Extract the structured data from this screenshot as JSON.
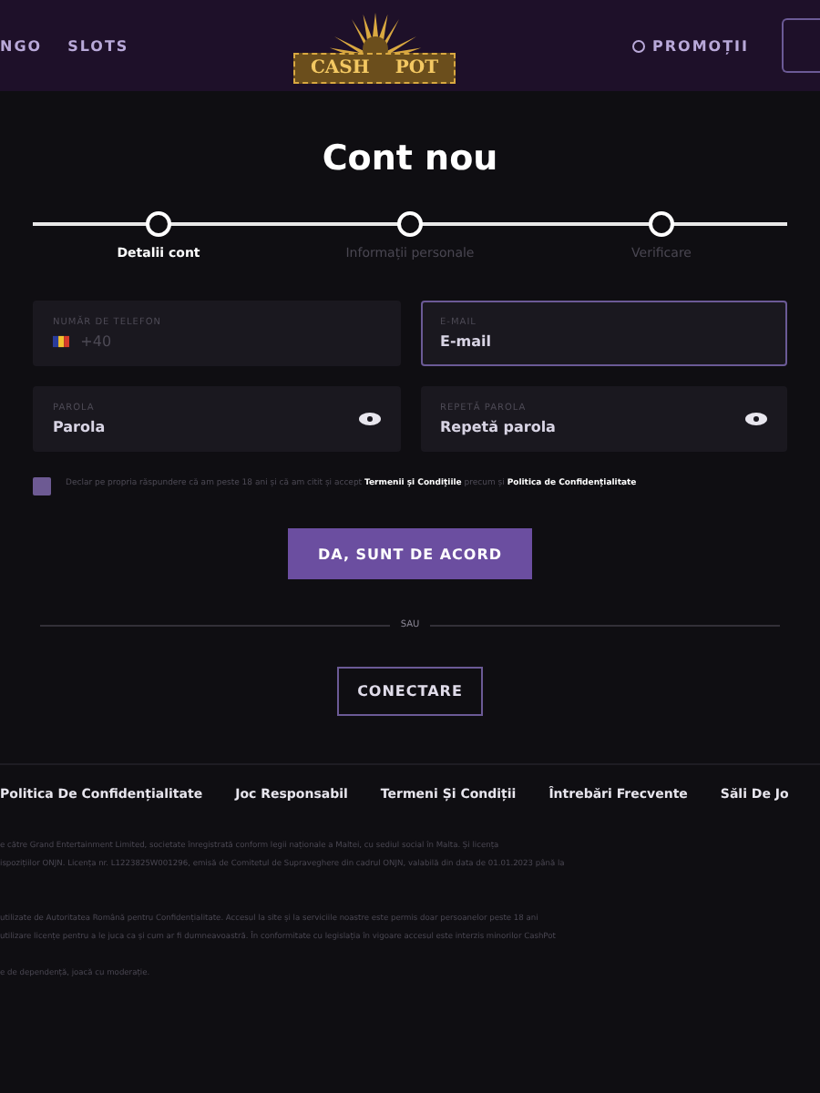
{
  "header": {
    "nav": [
      "NGO",
      "SLOTS"
    ],
    "logo": {
      "left": "CASH",
      "right": "POT"
    },
    "promo": "PROMOȚII"
  },
  "title": "Cont nou",
  "steps": [
    {
      "label": "Detalii cont",
      "selected": true
    },
    {
      "label": "Informații personale",
      "selected": false
    },
    {
      "label": "Verificare",
      "selected": false
    }
  ],
  "fields": [
    {
      "kind": "phone",
      "label": "NUMĂR DE TELEFON",
      "placeholder": "+40",
      "focused": false
    },
    {
      "kind": "text",
      "label": "E-MAIL",
      "placeholder": "E-mail",
      "focused": true
    },
    {
      "kind": "password",
      "label": "PAROLA",
      "placeholder": "Parola",
      "focused": false
    },
    {
      "kind": "password",
      "label": "REPETĂ PAROLA",
      "placeholder": "Repetă parola",
      "focused": false
    }
  ],
  "consent": {
    "checked": false,
    "text": "Declar pe propria răspundere că am peste 18 ani și că am citit și accept **Termenii și Condițiile** precum și **Politica de Confidențialitate**"
  },
  "agree_button": "DA, SUNT DE ACORD",
  "divider": "SAU",
  "login_button": "CONECTARE",
  "footer": {
    "links": [
      "Politica De Confidențialitate",
      "Joc Responsabil",
      "Termeni Și Condiții",
      "Întrebări Frecvente",
      "Săli De Jo"
    ],
    "paragraphs": [
      "e către Grand Entertainment Limited, societate înregistrată conform legii naționale a Maltei, cu sediul social în Malta. Și licența",
      "ispozițiilor ONJN. Licența nr. L1223825W001296, emisă de Comitetul de Supraveghere din cadrul ONJN, valabilă din data de 01.01.2023 până la",
      "utilizate de Autoritatea Română pentru Confidențialitate. Accesul la site și la serviciile noastre este permis doar persoanelor peste 18 ani",
      "utilizare licențe pentru a le juca ca și cum ar fi dumneavoastră. În conformitate cu legislația în vigoare accesul este interzis minorilor CashPot",
      "e de dependență, joacă cu moderație."
    ]
  }
}
